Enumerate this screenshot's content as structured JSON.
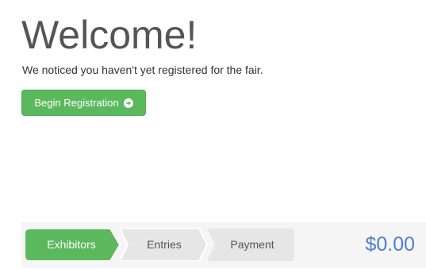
{
  "welcome": {
    "title": "Welcome!",
    "message": "We noticed you haven't yet registered for the fair.",
    "button_label": "Begin Registration",
    "button_icon": "arrow-circle-right-icon",
    "button_color": "#5cb85c"
  },
  "steps": {
    "items": [
      {
        "label": "Exhibitors",
        "active": true
      },
      {
        "label": "Entries",
        "active": false
      },
      {
        "label": "Payment",
        "active": false
      }
    ],
    "active_color": "#5cb85c",
    "inactive_color": "#e6e6e6"
  },
  "cart": {
    "total": "$0.00",
    "total_color": "#4f80c9"
  }
}
